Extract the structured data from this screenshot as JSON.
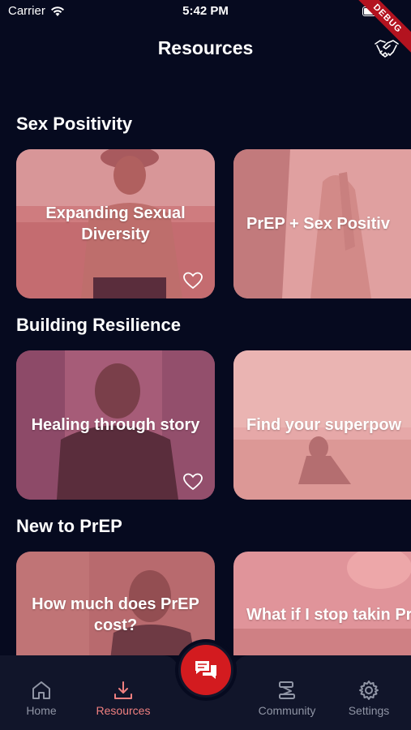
{
  "status": {
    "carrier": "Carrier",
    "time": "5:42 PM"
  },
  "debug_label": "DEBUG",
  "header": {
    "title": "Resources"
  },
  "sections": [
    {
      "title": "Sex Positivity",
      "cards": [
        {
          "label": "Expanding Sexual\nDiversity"
        },
        {
          "label": "PrEP + Sex Positiv"
        }
      ]
    },
    {
      "title": "Building Resilience",
      "cards": [
        {
          "label": "Healing through story"
        },
        {
          "label": "Find your superpow"
        }
      ]
    },
    {
      "title": "New to PrEP",
      "cards": [
        {
          "label": "How much does PrEP\ncost?"
        },
        {
          "label": "What if I stop takin\nPrEP and then star"
        }
      ]
    }
  ],
  "tabs": [
    {
      "label": "Home",
      "icon": "home-icon"
    },
    {
      "label": "Resources",
      "icon": "download-icon"
    },
    {
      "label": "Community",
      "icon": "community-icon"
    },
    {
      "label": "Settings",
      "icon": "gear-icon"
    }
  ],
  "fab": {
    "icon": "chat-icon"
  },
  "colors": {
    "background": "#060a1f",
    "card_tint": "#d9707a",
    "accent": "#f08080",
    "fab": "#d31b1f"
  }
}
